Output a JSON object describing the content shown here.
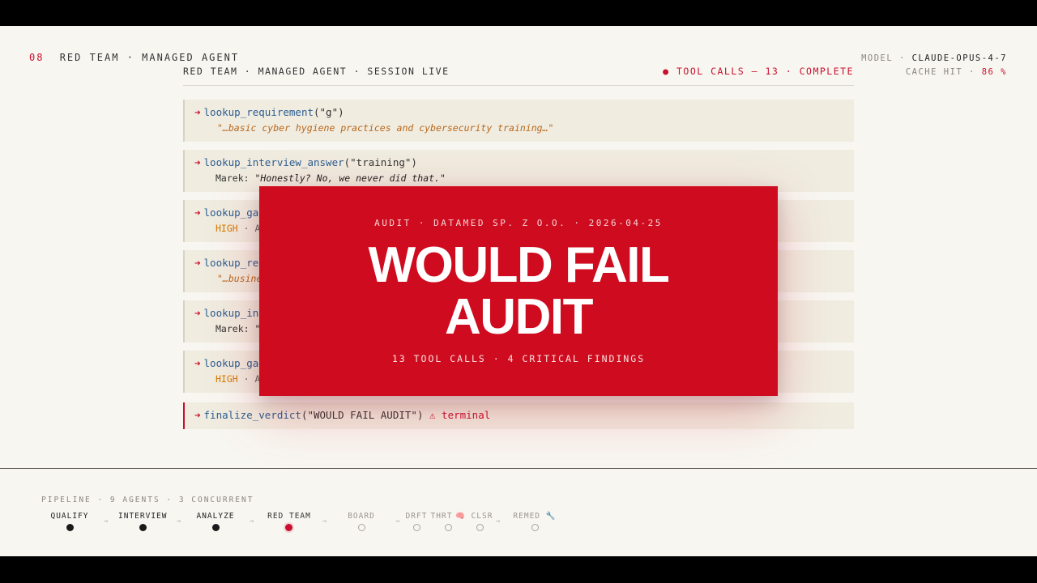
{
  "header": {
    "section_number": "08",
    "section_title": "RED TEAM · MANAGED AGENT",
    "model_label": "MODEL ·",
    "model_value": "CLAUDE-OPUS-4-7",
    "cache_label": "CACHE HIT ·",
    "cache_value": "86 %"
  },
  "session": {
    "title": "RED TEAM · MANAGED AGENT · SESSION LIVE",
    "status": "● TOOL CALLS — 13 · COMPLETE"
  },
  "tool_calls": [
    {
      "fn": "lookup_requirement",
      "args": "(\"g\")",
      "quote": "\"…basic cyber hygiene practices and cybersecurity training…\""
    },
    {
      "fn": "lookup_interview_answer",
      "args": "(\"training\")",
      "speaker": "Marek:",
      "speech": "\"Honestly? No, we never did that.\""
    },
    {
      "fn": "lookup_gap",
      "severity": "HIGH",
      "desc": "· A"
    },
    {
      "fn": "lookup_req",
      "quote": "\"…busine"
    },
    {
      "fn": "lookup_int",
      "speaker": "Marek:",
      "speech": "\""
    },
    {
      "fn": "lookup_gap",
      "severity": "HIGH",
      "desc": "· A"
    },
    {
      "fn": "finalize_verdict",
      "args": "(\"WOULD FAIL AUDIT\")",
      "terminal": "⚠ terminal"
    }
  ],
  "verdict": {
    "subtitle": "AUDIT · DATAMED SP. Z O.O. · 2026-04-25",
    "title_line1": "WOULD FAIL",
    "title_line2": "AUDIT",
    "footer": "13 TOOL CALLS · 4 CRITICAL FINDINGS"
  },
  "pipeline": {
    "label": "PIPELINE · 9 AGENTS · 3 CONCURRENT",
    "stages": [
      {
        "label": "QUALIFY",
        "status": "done"
      },
      {
        "label": "INTERVIEW",
        "status": "done"
      },
      {
        "label": "ANALYZE",
        "status": "done"
      },
      {
        "label": "RED TEAM",
        "status": "active"
      },
      {
        "label": "BOARD",
        "status": "pending"
      },
      {
        "label": "DRFT",
        "status": "pending"
      },
      {
        "label": "THRT",
        "status": "pending"
      },
      {
        "label": "🧠 CLSR",
        "status": "pending"
      },
      {
        "label": "REMED 🔧",
        "status": "pending"
      }
    ],
    "connector": "→"
  },
  "colors": {
    "accent": "#c8102e",
    "verdict_bg": "#cf0c1f",
    "background": "#f8f6f1",
    "card_bg": "#f0ece0"
  }
}
